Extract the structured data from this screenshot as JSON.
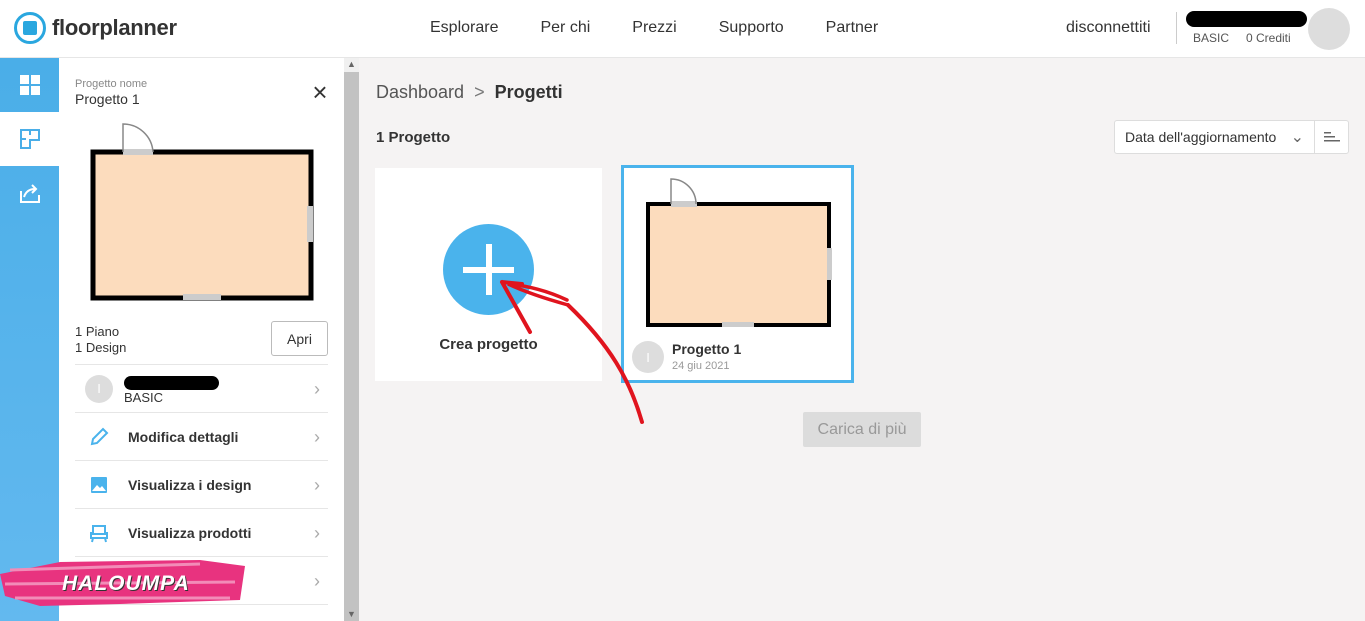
{
  "header": {
    "logo_text": "floorplanner",
    "nav": [
      "Esplorare",
      "Per chi",
      "Prezzi",
      "Supporto",
      "Partner"
    ],
    "logout": "disconnettiti",
    "plan_name": "BASIC",
    "credits": "0 Crediti"
  },
  "rail": {
    "items": [
      {
        "icon": "dashboard-grid-icon"
      },
      {
        "icon": "floorplan-icon",
        "active": true
      },
      {
        "icon": "share-icon"
      }
    ]
  },
  "panel": {
    "caption": "Progetto nome",
    "title": "Progetto 1",
    "floors": "1  Piano",
    "designs": "1  Design",
    "open_label": "Apri",
    "user_initial": "I",
    "user_plan": "BASIC",
    "menu": [
      {
        "label": "Modifica dettagli",
        "icon": "pencil-icon"
      },
      {
        "label": "Visualizza i design",
        "icon": "image-icon"
      },
      {
        "label": "Visualizza prodotti",
        "icon": "chair-icon"
      }
    ]
  },
  "main": {
    "breadcrumb_root": "Dashboard",
    "breadcrumb_sep": ">",
    "breadcrumb_current": "Progetti",
    "count_title": "1  Progetto",
    "sort_label": "Data dell'aggiornamento",
    "create_label": "Crea progetto",
    "project": {
      "name": "Progetto 1",
      "date": "24 giu 2021",
      "owner_initial": "I"
    },
    "load_more": "Carica di più"
  },
  "watermark": "HALOUMPA",
  "colors": {
    "accent": "#4ab3ec",
    "room_fill": "#fcdcbd",
    "annotation": "#e0141e"
  }
}
